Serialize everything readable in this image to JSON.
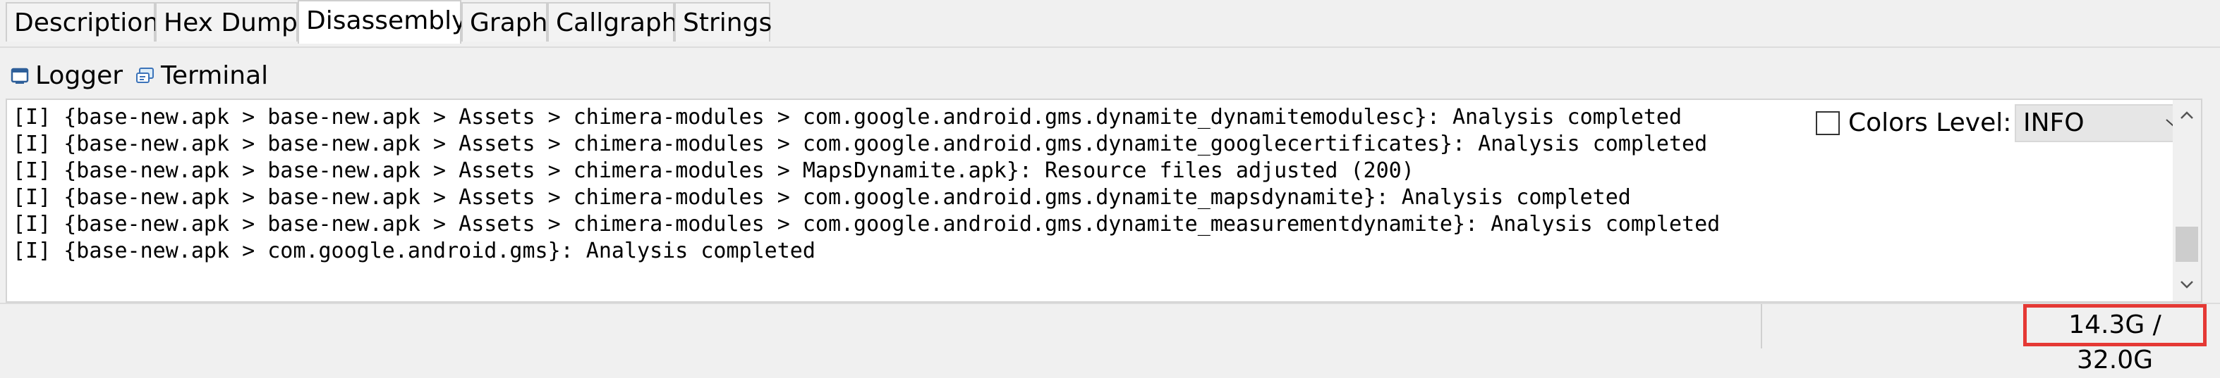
{
  "top_tabs": [
    {
      "label": "Description"
    },
    {
      "label": "Hex Dump"
    },
    {
      "label": "Disassembly",
      "active": true
    },
    {
      "label": "Graph"
    },
    {
      "label": "Callgraph"
    },
    {
      "label": "Strings"
    }
  ],
  "panel_tabs": [
    {
      "label": "Logger",
      "icon": "logger-icon",
      "active": true
    },
    {
      "label": "Terminal",
      "icon": "terminal-icon"
    }
  ],
  "log": [
    "[I] {base-new.apk > base-new.apk > Assets > chimera-modules > com.google.android.gms.dynamite_dynamitemodulesc}: Analysis completed",
    "[I] {base-new.apk > base-new.apk > Assets > chimera-modules > com.google.android.gms.dynamite_googlecertificates}: Analysis completed",
    "[I] {base-new.apk > base-new.apk > Assets > chimera-modules > MapsDynamite.apk}: Resource files adjusted (200)",
    "[I] {base-new.apk > base-new.apk > Assets > chimera-modules > com.google.android.gms.dynamite_mapsdynamite}: Analysis completed",
    "[I] {base-new.apk > base-new.apk > Assets > chimera-modules > com.google.android.gms.dynamite_measurementdynamite}: Analysis completed",
    "[I] {base-new.apk > com.google.android.gms}: Analysis completed"
  ],
  "controls": {
    "colors_label": "Colors Level:",
    "colors_checked": false,
    "level_value": "INFO"
  },
  "status": {
    "memory": "14.3G / 32.0G"
  },
  "colors": {
    "highlight": "#e53935"
  }
}
